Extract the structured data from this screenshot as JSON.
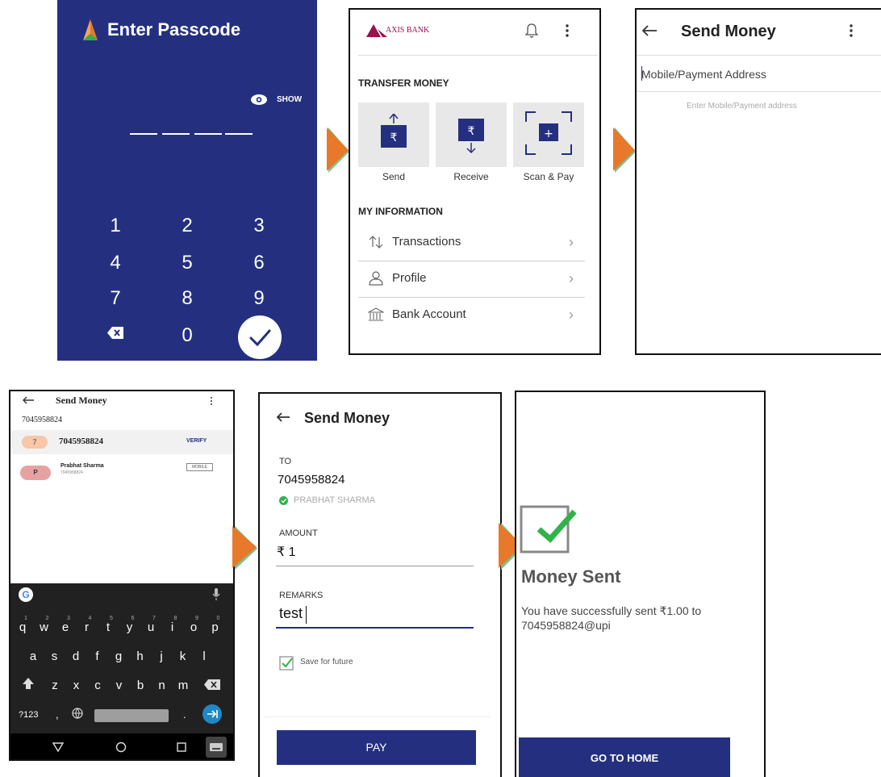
{
  "colors": {
    "navy": "#24307f",
    "axis_red": "#97144d",
    "arrow_orange": "#e8782a",
    "arrow_green": "#7bc08f",
    "success_green": "#2fb34a"
  },
  "screen1": {
    "title": "Enter Passcode",
    "show_label": "SHOW",
    "keys": [
      "1",
      "2",
      "3",
      "4",
      "5",
      "6",
      "7",
      "8",
      "9",
      "0"
    ],
    "icons": {
      "logo": "bhim-logo-icon",
      "eye": "eye-icon",
      "backspace": "backspace-icon",
      "submit": "check-icon"
    }
  },
  "screen2": {
    "brand": "AXIS BANK",
    "transfer_heading": "TRANSFER MONEY",
    "tiles": [
      {
        "label": "Send"
      },
      {
        "label": "Receive"
      },
      {
        "label": "Scan & Pay"
      }
    ],
    "info_heading": "MY INFORMATION",
    "menu": [
      {
        "label": "Transactions"
      },
      {
        "label": "Profile"
      },
      {
        "label": "Bank Account"
      }
    ]
  },
  "screen3": {
    "title": "Send Money",
    "input_placeholder": "Mobile/Payment Address",
    "hint": "Enter Mobile/Payment address"
  },
  "screen4": {
    "title": "Send Money",
    "query": "7045958824",
    "suggestion": {
      "avatar": "7",
      "number": "7045958824",
      "action": "VERIFY"
    },
    "contact": {
      "avatar": "P",
      "name": "Prabhat Sharma",
      "number": "7045958824",
      "tag": "MOBILE"
    },
    "keyboard": {
      "row1": [
        "q",
        "w",
        "e",
        "r",
        "t",
        "y",
        "u",
        "i",
        "o",
        "p"
      ],
      "row1_hints": [
        "1",
        "2",
        "3",
        "4",
        "5",
        "6",
        "7",
        "8",
        "9",
        "0"
      ],
      "row2": [
        "a",
        "s",
        "d",
        "f",
        "g",
        "h",
        "j",
        "k",
        "l"
      ],
      "row3": [
        "z",
        "x",
        "c",
        "v",
        "b",
        "n",
        "m"
      ],
      "symbols": "?123",
      "comma": ",",
      "period": "."
    }
  },
  "screen5": {
    "title": "Send Money",
    "to_label": "TO",
    "to_value": "7045958824",
    "verified_name": "PRABHAT SHARMA",
    "amount_label": "AMOUNT",
    "amount_value": "₹ 1",
    "remarks_label": "REMARKS",
    "remarks_value": "test",
    "save_label": "Save for future",
    "save_checked": true,
    "pay_button": "PAY"
  },
  "screen6": {
    "heading": "Money Sent",
    "message": "You have successfully sent ₹1.00 to 7045958824@upi",
    "home_button": "GO TO HOME"
  }
}
